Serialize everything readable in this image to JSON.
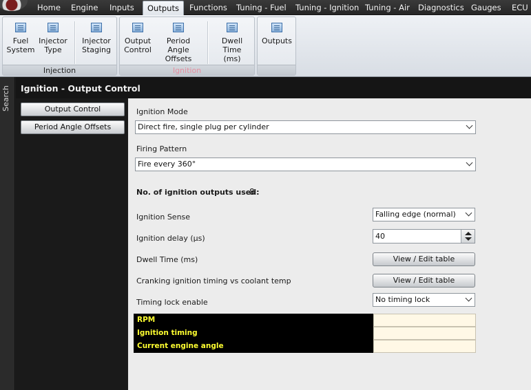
{
  "menu": {
    "items": [
      "Home",
      "Engine",
      "Inputs",
      "Outputs",
      "Functions",
      "Tuning - Fuel",
      "Tuning - Ignition",
      "Tuning - Air",
      "Diagnostics",
      "Gauges",
      "ECU H"
    ],
    "active": "Outputs"
  },
  "ribbon": {
    "injection": {
      "label": "Injection",
      "buttons": [
        {
          "label": "Fuel\nSystem",
          "icon": "table-icon"
        },
        {
          "label": "Injector\nType",
          "icon": "table-icon"
        },
        {
          "label": "Injector\nStaging",
          "icon": "table-icon"
        }
      ]
    },
    "ignition": {
      "label": "Ignition",
      "label_color": "#e48fa0",
      "buttons": [
        {
          "label": "Output\nControl",
          "icon": "table-icon"
        },
        {
          "label": "Period Angle\nOffsets",
          "icon": "table-icon"
        },
        {
          "label": "Dwell Time\n(ms)",
          "icon": "grid-icon"
        }
      ]
    },
    "outputs": {
      "label": "",
      "buttons": [
        {
          "label": "Outputs",
          "icon": "table-icon"
        }
      ]
    }
  },
  "sidebar": {
    "search_label": "Search"
  },
  "page": {
    "title": "Ignition - Output Control"
  },
  "nav": {
    "buttons": [
      "Output Control",
      "Period Angle Offsets"
    ]
  },
  "form": {
    "ignition_mode": {
      "label": "Ignition Mode",
      "value": "Direct fire, single plug per cylinder"
    },
    "firing_pattern": {
      "label": "Firing Pattern",
      "value": "Fire every 360°"
    },
    "outputs_used": {
      "label": "No. of ignition outputs used:",
      "value": "8"
    },
    "ignition_sense": {
      "label": "Ignition Sense",
      "value": "Falling edge (normal)"
    },
    "ignition_delay": {
      "label": "Ignition delay (µs)",
      "value": "40"
    },
    "dwell_time": {
      "label": "Dwell Time (ms)",
      "button": "View / Edit table"
    },
    "cranking_timing": {
      "label": "Cranking ignition timing vs coolant temp",
      "button": "View / Edit table"
    },
    "timing_lock": {
      "label": "Timing lock enable",
      "value": "No timing lock"
    }
  },
  "live": {
    "rows": [
      {
        "label": "RPM",
        "value": ""
      },
      {
        "label": "Ignition timing",
        "value": ""
      },
      {
        "label": "Current engine angle",
        "value": ""
      }
    ]
  },
  "colors": {
    "live_label_text": "#ffff30",
    "live_value_bg": "#fff8e6",
    "ribbon_accent": "#3c6fa8"
  }
}
